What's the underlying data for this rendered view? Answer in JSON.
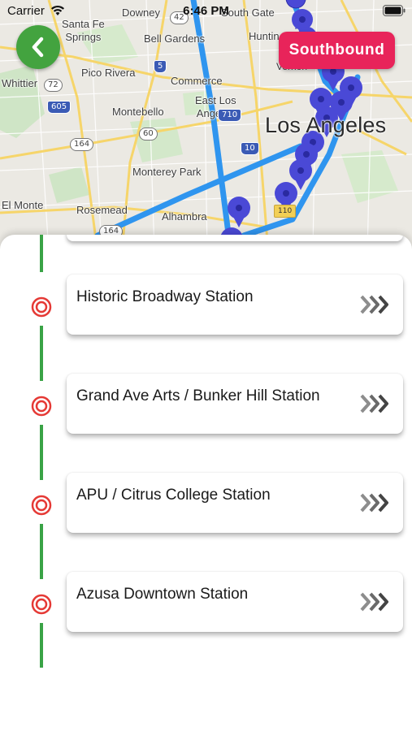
{
  "status_bar": {
    "carrier": "Carrier",
    "time": "6:46 PM"
  },
  "map": {
    "labels": {
      "santa_fe_springs": "Santa Fe\nSprings",
      "downey": "Downey",
      "south_gate": "South Gate",
      "huntington": "Huntin",
      "vernon": "Vernon",
      "bell_gardens": "Bell Gardens",
      "pico_rivera": "Pico Rivera",
      "commerce": "Commerce",
      "whittier": "Whittier",
      "east_los_angeles": "East Los\nAngeles",
      "montebello": "Montebello",
      "los_angeles": "Los Angeles",
      "monterey_park": "Monterey Park",
      "el_monte": "El Monte",
      "rosemead": "Rosemead",
      "alhambra": "Alhambra"
    },
    "shields": {
      "s42": "42",
      "s72": "72",
      "s5": "5",
      "s710": "710",
      "s605": "605",
      "s60": "60",
      "s164a": "164",
      "s10": "10",
      "s164b": "164",
      "s110": "110"
    },
    "route_color": "#2f95ef",
    "pin_color": "#4a49d6"
  },
  "controls": {
    "back_icon": "chevron-left-icon",
    "back_color": "#43a33f",
    "direction_label": "Southbound",
    "direction_color": "#e8245a"
  },
  "timeline_color": "#3aa346",
  "marker_color": "#e53935",
  "stations": [
    {
      "name": "Historic Broadway Station"
    },
    {
      "name": "Grand Ave Arts / Bunker Hill Station"
    },
    {
      "name": "APU / Citrus College Station"
    },
    {
      "name": "Azusa Downtown Station"
    }
  ]
}
